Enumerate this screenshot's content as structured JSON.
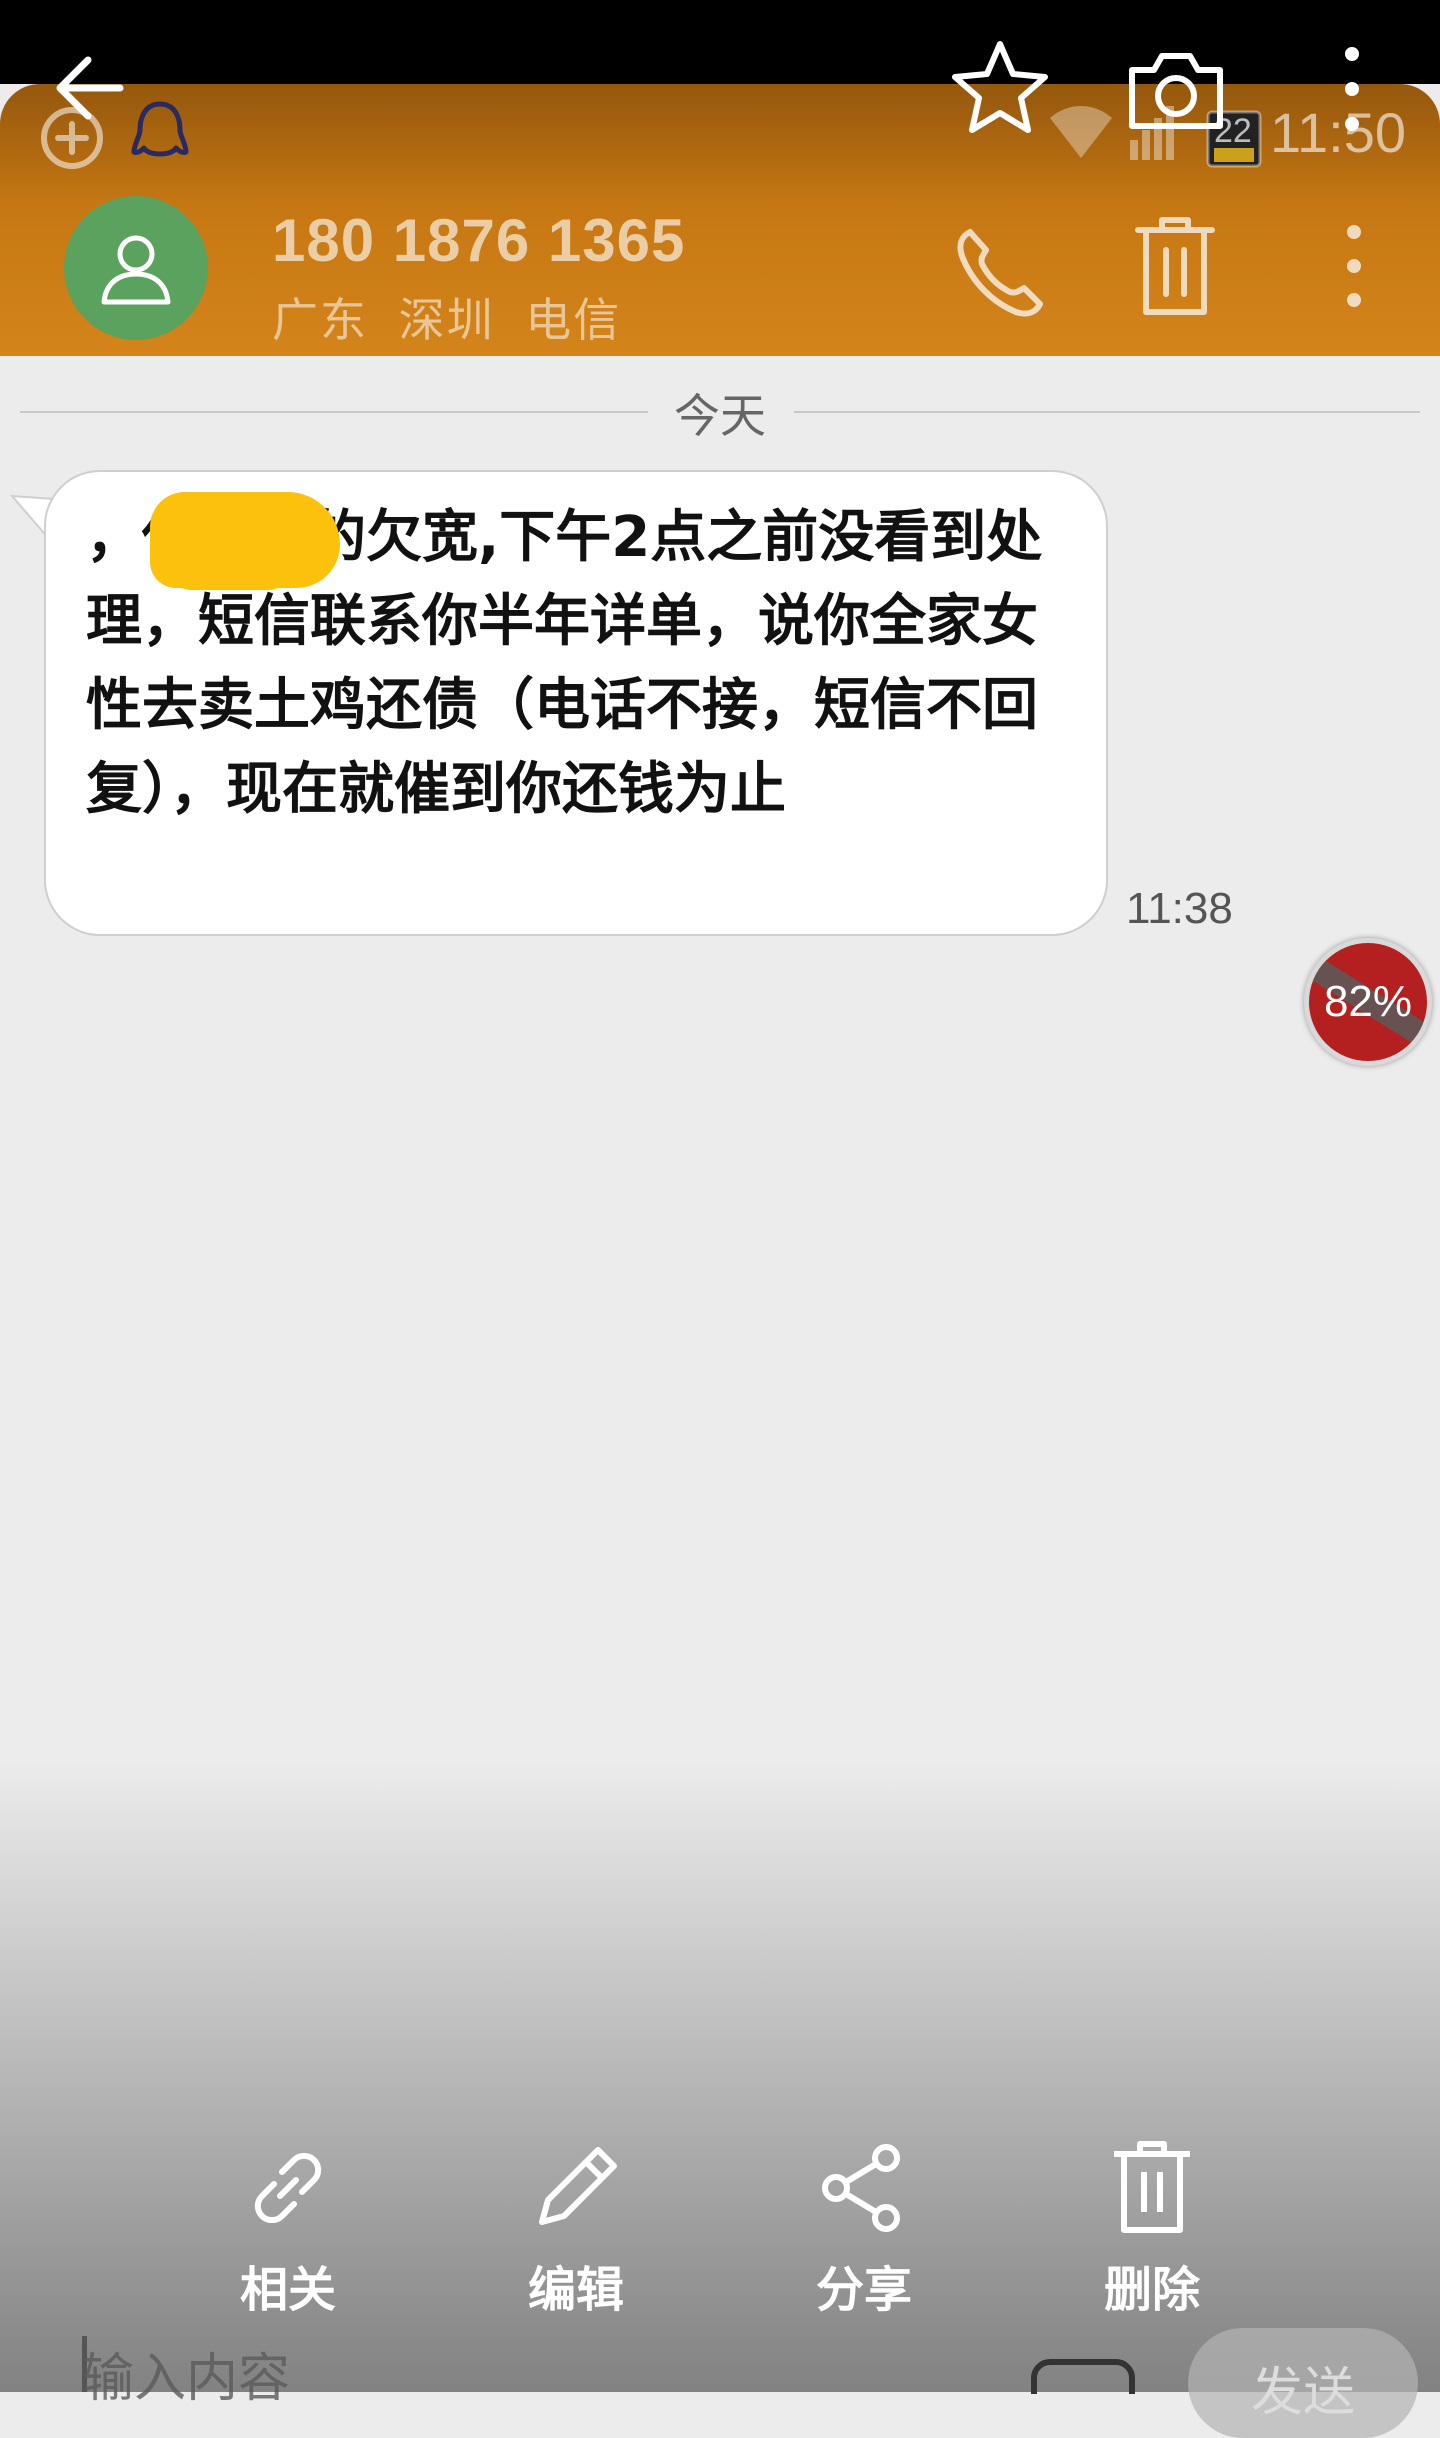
{
  "status_bar": {
    "time": "11:50",
    "signal_badge": "22",
    "icons": [
      "add-circle-icon",
      "qq-penguin-icon",
      "wifi-icon",
      "cell-signal-icon",
      "battery-icon"
    ]
  },
  "overlay_toolbar": {
    "icons": [
      "back-arrow-icon",
      "star-icon",
      "camera-icon",
      "more-vertical-icon"
    ]
  },
  "contact": {
    "number": "180 1876 1365",
    "location": "广东 深圳 电信"
  },
  "header_actions": [
    "phone-icon",
    "trash-icon",
    "more-vertical-icon"
  ],
  "date_divider": "今天",
  "message": {
    "text": "        ，借錢筷的欠宽,下午2点之前没看到处理，短信联系你半年详单，说你全家女性去卖土鸡还债（电话不接，短信不回复），现在就催到你还钱为止",
    "time": "11:38"
  },
  "floating_badge": "82%",
  "actions": [
    {
      "icon": "link-icon",
      "label": "相关"
    },
    {
      "icon": "pencil-icon",
      "label": "编辑"
    },
    {
      "icon": "share-icon",
      "label": "分享"
    },
    {
      "icon": "trash-icon",
      "label": "删除"
    }
  ],
  "compose": {
    "placeholder": "输入内容",
    "send_label": "发送"
  },
  "colors": {
    "header": "#c97a14",
    "avatar": "#5aa25d",
    "badge": "#b41f1f",
    "redaction": "#fbc10c"
  }
}
